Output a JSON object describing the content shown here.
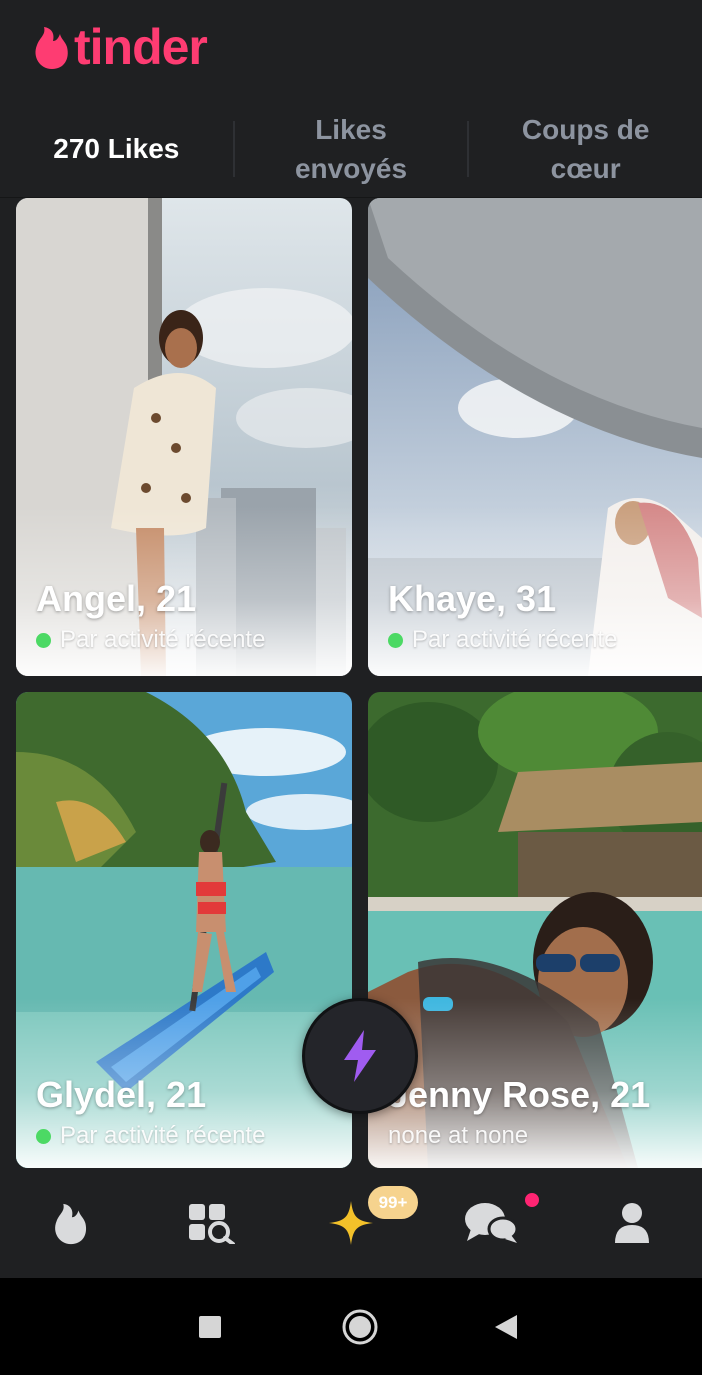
{
  "app": {
    "logo_text": "tinder",
    "brand_color": "#fe3c72"
  },
  "tabs": [
    {
      "label": "270 Likes",
      "active": true
    },
    {
      "label": "Likes envoyés",
      "active": false
    },
    {
      "label": "Coups de cœur",
      "active": false
    }
  ],
  "cards": [
    {
      "name": "Angel, 21",
      "status": "Par activité récente",
      "online": true
    },
    {
      "name": "Khaye, 31",
      "status": "Par activité récente",
      "online": true
    },
    {
      "name": "Glydel, 21",
      "status": "Par activité récente",
      "online": true
    },
    {
      "name": "Jenny Rose, 21",
      "status": "none at none",
      "online": false
    }
  ],
  "boost": {
    "icon": "lightning-icon",
    "color": "#a05cf0"
  },
  "bottom_nav": {
    "items": [
      "flame-icon",
      "explore-icon",
      "gold-likes-icon",
      "messages-icon",
      "profile-icon"
    ],
    "likes_badge": "99+",
    "badge_color": "#f6d38e",
    "messages_dot_color": "#fe2472"
  },
  "system_nav": [
    "recents-icon",
    "home-icon",
    "back-icon"
  ]
}
